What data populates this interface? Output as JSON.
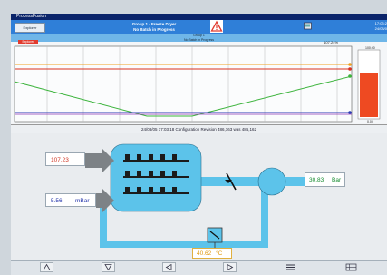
{
  "titlebar": {
    "text": "ProcessFusion"
  },
  "header": {
    "button_label": "Explorer",
    "group_title": "Group 1 - Freeze Dryer",
    "group_status": "No Batch in Progress",
    "time": "17:03:2",
    "date": "24/08/0"
  },
  "subheader": {
    "line1": "Group 1",
    "line2": "No Batch in Progress"
  },
  "trend": {
    "tag": "Explorer",
    "readout": "107.24%",
    "footer": "24/08/05 17:03:18 Configuration Revision 486,163 was 486,162",
    "bar_top": "100.00",
    "bar_bottom": "0.00",
    "bar_color": "#ee4a22"
  },
  "mimic": {
    "value1": "107.23",
    "value2": "5.56",
    "value2_unit": "mBar",
    "value3": "30.83",
    "value3_unit": "Bar",
    "value4": "40.62",
    "value4_unit": "°C"
  },
  "colors": {
    "vessel": "#5cc3ea",
    "header": "#2f7fd8",
    "alarm": "#e23b2e"
  },
  "toolbar_icons": [
    "up-triangle-icon",
    "down-triangle-icon",
    "left-triangle-icon",
    "right-triangle-icon",
    "menu-icon",
    "grid-icon"
  ]
}
